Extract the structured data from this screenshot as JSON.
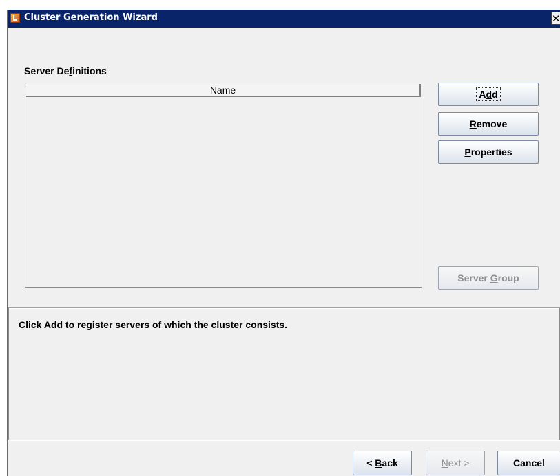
{
  "window": {
    "title": "Cluster Generation Wizard",
    "close_glyph": "✕",
    "icon": "java-app-icon"
  },
  "section": {
    "label_pre": "Server De",
    "label_mnemonic": "f",
    "label_post": "initions"
  },
  "table": {
    "columns": [
      "Name"
    ],
    "rows": []
  },
  "buttons": {
    "add": {
      "pre": "A",
      "mnemonic": "d",
      "post": "d"
    },
    "remove": {
      "pre": "",
      "mnemonic": "R",
      "post": "emove"
    },
    "properties": {
      "pre": "",
      "mnemonic": "P",
      "post": "roperties"
    },
    "server_group": {
      "pre": "Server ",
      "mnemonic": "G",
      "post": "roup",
      "disabled": true
    }
  },
  "message": "Click Add to register servers of which the cluster consists.",
  "nav": {
    "back": {
      "pre": "< ",
      "mnemonic": "B",
      "post": "ack"
    },
    "next": {
      "pre": "",
      "mnemonic": "N",
      "post": "ext >",
      "disabled": true
    },
    "cancel": {
      "label": "Cancel"
    }
  },
  "colors": {
    "titlebar": "#0a246a",
    "panel": "#f0f0f0",
    "disabled_text": "#8e8e8e"
  }
}
